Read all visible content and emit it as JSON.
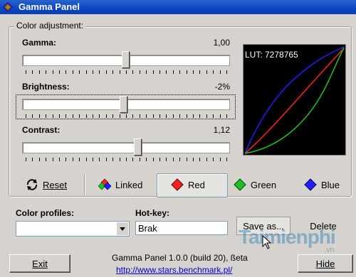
{
  "window": {
    "title": "Gamma Panel"
  },
  "group": {
    "label": "Color adjustment:"
  },
  "sliders": {
    "gamma": {
      "label": "Gamma:",
      "value": "1,00",
      "level": 0.5
    },
    "brightness": {
      "label": "Brightness:",
      "value": "-2%",
      "level": 0.49
    },
    "contrast": {
      "label": "Contrast:",
      "value": "1,12",
      "level": 0.56
    }
  },
  "lut": {
    "label": "LUT: 7278765"
  },
  "channel_buttons": {
    "reset": "Reset",
    "linked": "Linked",
    "red": "Red",
    "green": "Green",
    "blue": "Blue"
  },
  "profiles": {
    "label": "Color profiles:",
    "value": ""
  },
  "hotkey": {
    "label": "Hot-key:",
    "value": "Brak"
  },
  "actions": {
    "save_as": "Save as...",
    "delete": "Delete",
    "exit": "Exit",
    "hide": "Hide"
  },
  "footer": {
    "title": "Gamma Panel 1.0.0 (build 20), ßeta",
    "link": "http://www.stars.benchmark.pl/"
  },
  "watermark": {
    "main": "Taimienphi",
    "sub": ".vn"
  },
  "colors": {
    "red": "#ff2020",
    "green": "#20c020",
    "blue": "#2020ff",
    "titlebar": "#0a46c2"
  }
}
